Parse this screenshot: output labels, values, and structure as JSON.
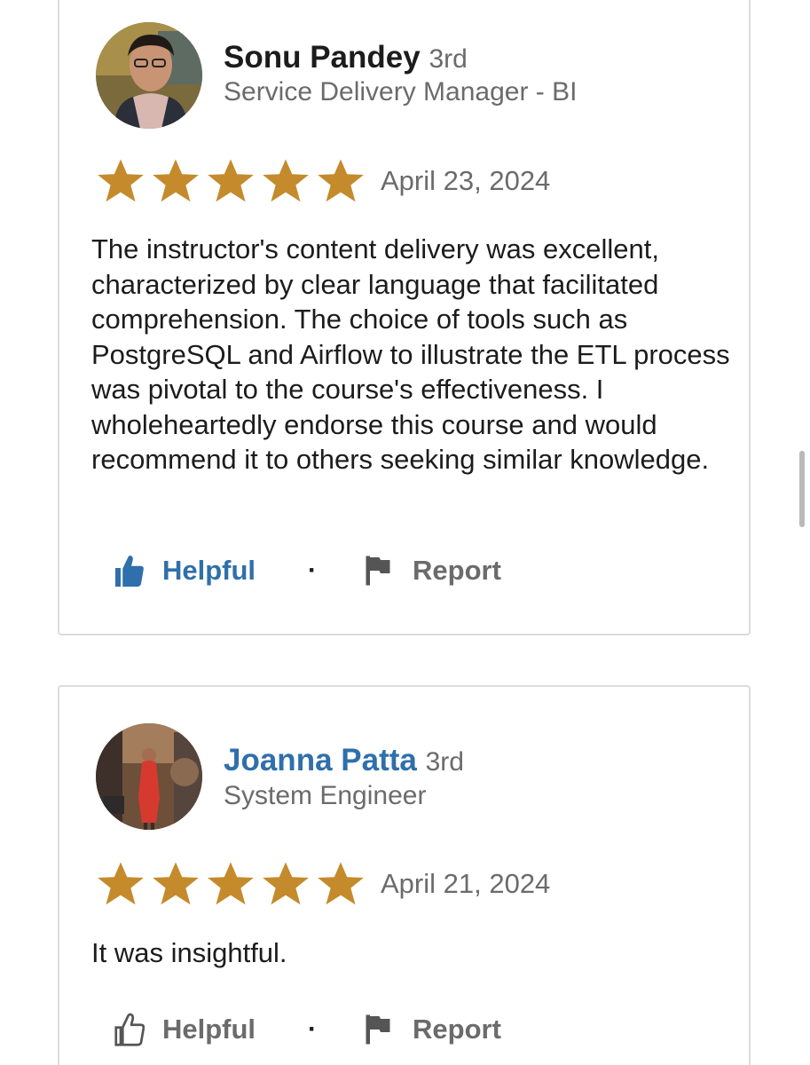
{
  "reviews": [
    {
      "name": "Sonu Pandey",
      "degree": "3rd",
      "headline": "Service Delivery Manager - BI",
      "rating": 5,
      "date": "April 23, 2024",
      "text": "The instructor's content delivery was excellent, characterized by clear language that facilitated comprehension. The choice of tools such as PostgreSQL and Airflow to illustrate the ETL process was pivotal to the course's effectiveness. I wholeheartedly endorse this course and would recommend it to others seeking similar knowledge.",
      "helpful_label": "Helpful",
      "helpful_active": true,
      "separator": "·",
      "report_label": "Report"
    },
    {
      "name": "Joanna Patta",
      "degree": "3rd",
      "headline": "System Engineer",
      "rating": 5,
      "date": "April 21, 2024",
      "text": "It was insightful.",
      "helpful_label": "Helpful",
      "helpful_active": false,
      "separator": "·",
      "report_label": "Report"
    }
  ],
  "colors": {
    "star": "#c48a2c",
    "link": "#2f6fab",
    "text": "#1c1c1c",
    "muted": "#6b6b6b",
    "border": "#dcdcdc"
  },
  "icons": {
    "helpful_active": "thumbs-up-filled-icon",
    "helpful_inactive": "thumbs-up-outline-icon",
    "report": "flag-icon",
    "rating": "star-icon"
  }
}
